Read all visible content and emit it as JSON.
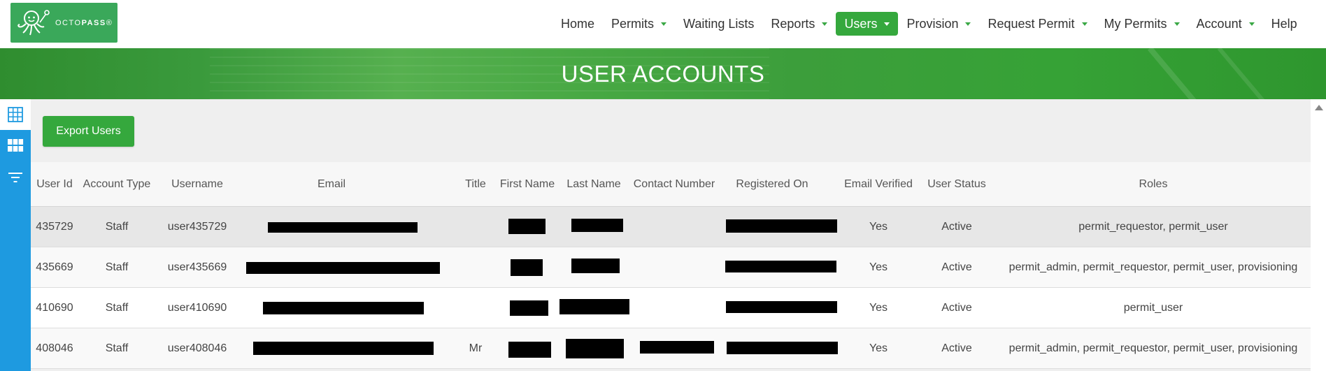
{
  "brand": {
    "name_prefix": "OCTO",
    "name_suffix": "PASS",
    "mark": "®"
  },
  "nav": {
    "items": [
      {
        "label": "Home",
        "dropdown": false,
        "active": false
      },
      {
        "label": "Permits",
        "dropdown": true,
        "active": false
      },
      {
        "label": "Waiting Lists",
        "dropdown": false,
        "active": false
      },
      {
        "label": "Reports",
        "dropdown": true,
        "active": false
      },
      {
        "label": "Users",
        "dropdown": true,
        "active": true
      },
      {
        "label": "Provision",
        "dropdown": true,
        "active": false
      },
      {
        "label": "Request Permit",
        "dropdown": true,
        "active": false
      },
      {
        "label": "My Permits",
        "dropdown": true,
        "active": false
      },
      {
        "label": "Account",
        "dropdown": true,
        "active": false
      },
      {
        "label": "Help",
        "dropdown": false,
        "active": false
      }
    ]
  },
  "banner": {
    "title": "USER ACCOUNTS"
  },
  "sidebar": {
    "icons": [
      "grid-view-icon",
      "tiles-view-icon",
      "filter-icon"
    ]
  },
  "toolbar": {
    "export_label": "Export Users"
  },
  "table": {
    "headers": {
      "user_id": "User Id",
      "account_type": "Account Type",
      "username": "Username",
      "email": "Email",
      "title": "Title",
      "first_name": "First Name",
      "last_name": "Last Name",
      "contact_number": "Contact Number",
      "registered_on": "Registered On",
      "email_verified": "Email Verified",
      "user_status": "User Status",
      "roles": "Roles"
    },
    "rows": [
      {
        "user_id": "435729",
        "account_type": "Staff",
        "username": "user435729",
        "title": "",
        "email_verified": "Yes",
        "user_status": "Active",
        "roles": "permit_requestor, permit_user"
      },
      {
        "user_id": "435669",
        "account_type": "Staff",
        "username": "user435669",
        "title": "",
        "email_verified": "Yes",
        "user_status": "Active",
        "roles": "permit_admin, permit_requestor, permit_user, provisioning"
      },
      {
        "user_id": "410690",
        "account_type": "Staff",
        "username": "user410690",
        "title": "",
        "email_verified": "Yes",
        "user_status": "Active",
        "roles": "permit_user"
      },
      {
        "user_id": "408046",
        "account_type": "Staff",
        "username": "user408046",
        "title": "Mr",
        "email_verified": "Yes",
        "user_status": "Active",
        "roles": "permit_admin, permit_requestor, permit_user, provisioning"
      }
    ]
  },
  "colors": {
    "brand_green": "#35a83d",
    "sidebar_blue": "#1e9ae0",
    "redaction": "#000000"
  }
}
